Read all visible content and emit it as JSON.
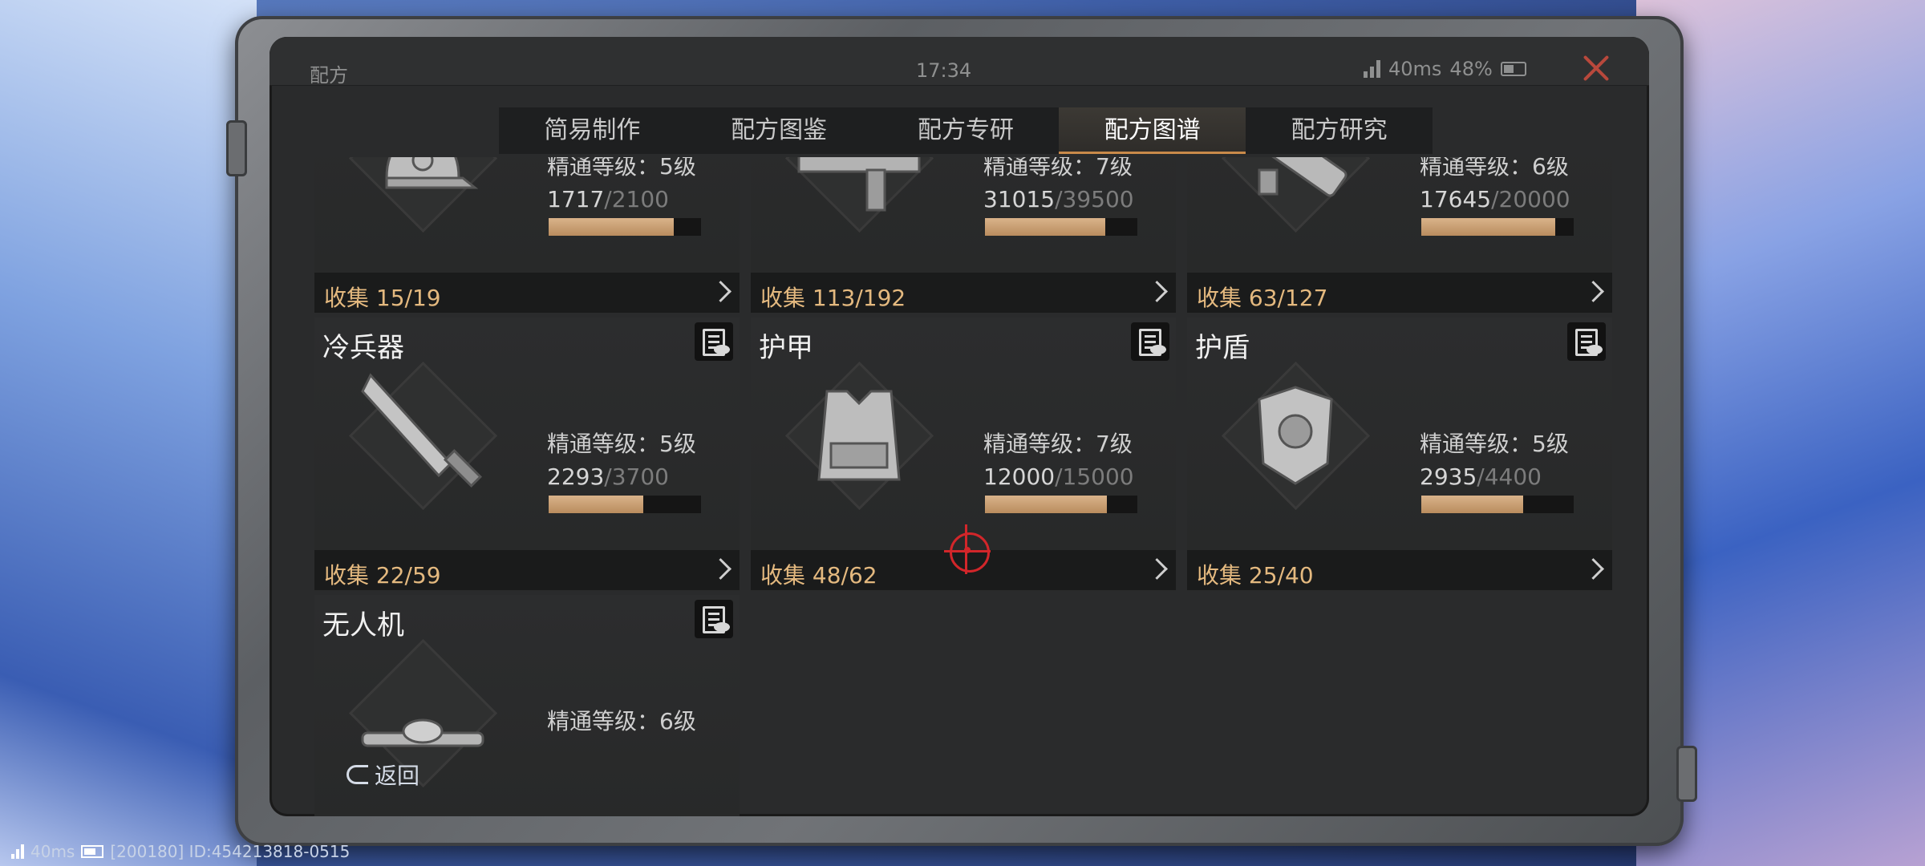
{
  "status_bar": {
    "title": "配方",
    "time": "17:34",
    "ping": "40ms",
    "battery": "48%"
  },
  "tabs": [
    {
      "label": "简易制作",
      "active": false
    },
    {
      "label": "配方图鉴",
      "active": false
    },
    {
      "label": "配方专研",
      "active": false
    },
    {
      "label": "配方图谱",
      "active": true
    },
    {
      "label": "配方研究",
      "active": false
    }
  ],
  "cards": [
    {
      "title": "",
      "icon": "cap-icon",
      "level": "精通等级：5级",
      "current": "1717",
      "max": "/2100",
      "progress": 0.82,
      "collect": "收集 15/19"
    },
    {
      "title": "",
      "icon": "smg-icon",
      "level": "精通等级：7级",
      "current": "31015",
      "max": "/39500",
      "progress": 0.79,
      "collect": "收集 113/192"
    },
    {
      "title": "",
      "icon": "launcher-icon",
      "level": "精通等级：6级",
      "current": "17645",
      "max": "/20000",
      "progress": 0.88,
      "collect": "收集 63/127"
    },
    {
      "title": "冷兵器",
      "icon": "knife-icon",
      "level": "精通等级：5级",
      "current": "2293",
      "max": "/3700",
      "progress": 0.62,
      "collect": "收集 22/59"
    },
    {
      "title": "护甲",
      "icon": "vest-icon",
      "level": "精通等级：7级",
      "current": "12000",
      "max": "/15000",
      "progress": 0.8,
      "collect": "收集 48/62"
    },
    {
      "title": "护盾",
      "icon": "shield-armor-icon",
      "level": "精通等级：5级",
      "current": "2935",
      "max": "/4400",
      "progress": 0.67,
      "collect": "收集 25/40"
    },
    {
      "title": "无人机",
      "icon": "drone-icon",
      "level": "精通等级：6级"
    }
  ],
  "back_label": "返回",
  "bottom_status": {
    "ping": "40ms",
    "id_text": "[200180] ID:454213818-0515"
  },
  "colors": {
    "accent": "#c98a4a",
    "collect_text": "#e4b97f",
    "close": "#b8483c",
    "target": "#d2262a"
  }
}
